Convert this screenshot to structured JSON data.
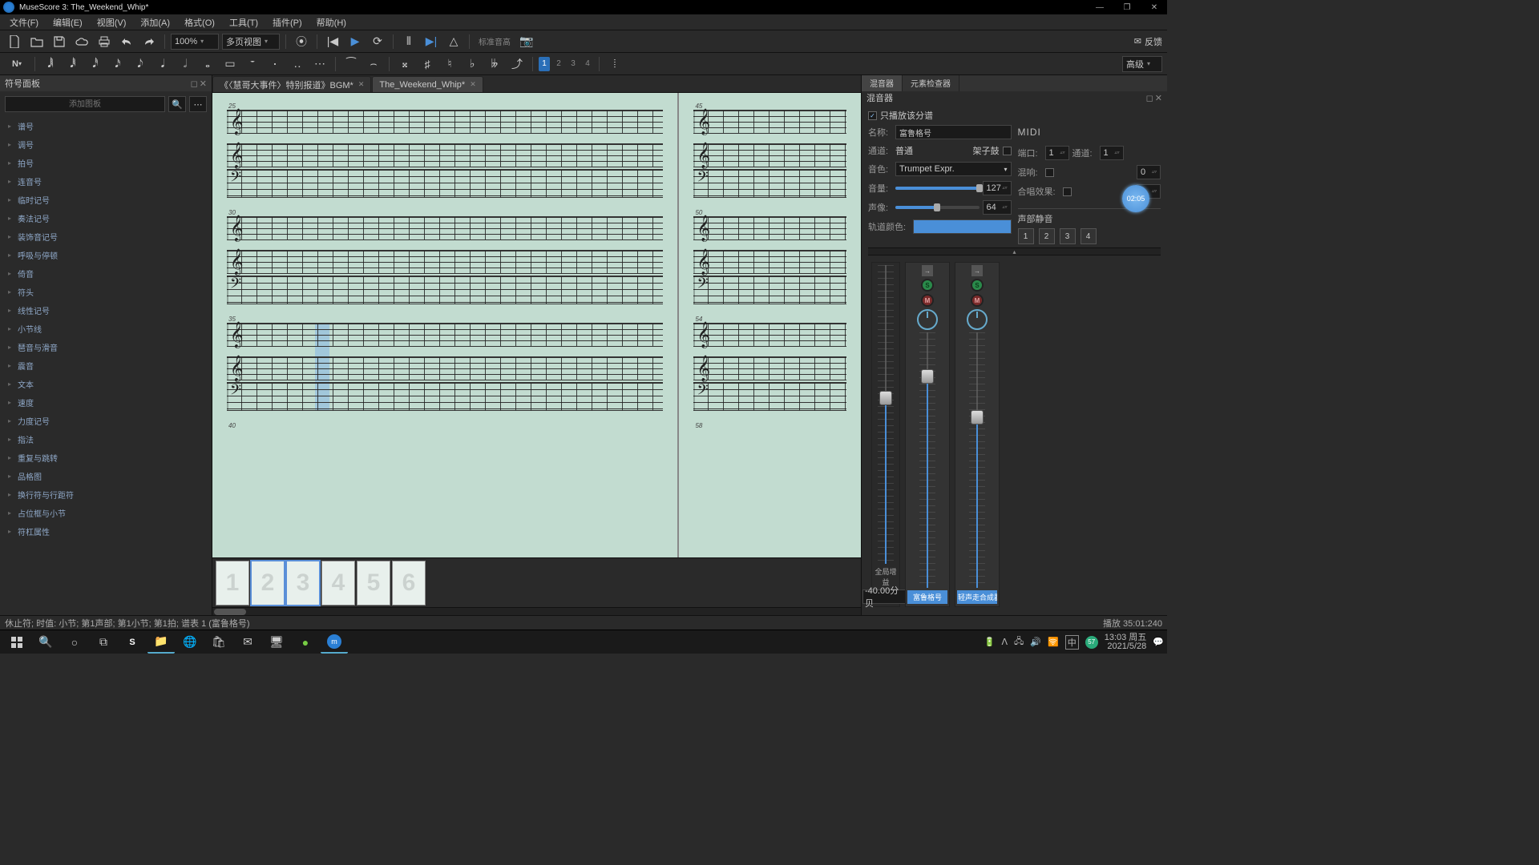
{
  "title": "MuseScore 3: The_Weekend_Whip*",
  "menu": [
    "文件(F)",
    "编辑(E)",
    "视图(V)",
    "添加(A)",
    "格式(O)",
    "工具(T)",
    "插件(P)",
    "帮助(H)"
  ],
  "toolbar1": {
    "zoom": "100%",
    "view": "多页视图",
    "pitch": "标准音高",
    "feedback": "反馈"
  },
  "toolbar2": {
    "voices": [
      "1",
      "2",
      "3",
      "4"
    ],
    "voice_active": 0,
    "level": "高级"
  },
  "palette": {
    "title": "符号面板",
    "search_placeholder": "添加图板",
    "items": [
      "谱号",
      "调号",
      "拍号",
      "连音号",
      "临时记号",
      "奏法记号",
      "装饰音记号",
      "呼吸与停顿",
      "倚音",
      "符头",
      "线性记号",
      "小节线",
      "琶音与滑音",
      "震音",
      "文本",
      "速度",
      "力度记号",
      "指法",
      "重复与跳转",
      "品格图",
      "换行符与行距符",
      "占位框与小节",
      "符杠属性"
    ]
  },
  "docs": [
    {
      "label": "《〈慧哥大事件〉特别报道》BGM*",
      "active": false
    },
    {
      "label": "The_Weekend_Whip*",
      "active": true
    }
  ],
  "score": {
    "measure_nums_left": [
      "25",
      "30",
      "35",
      "40"
    ],
    "measure_nums_right": [
      "45",
      "50",
      "54",
      "58"
    ],
    "pages": [
      1,
      2,
      3,
      4,
      5,
      6
    ],
    "selected_pages": [
      2,
      3
    ]
  },
  "right": {
    "tabs": [
      "混音器",
      "元素检查器"
    ],
    "tab_active": 0,
    "subtitle": "混音器",
    "only_play_sub": "只播放该分谱",
    "name_label": "名称:",
    "name_value": "富鲁格号",
    "channel_label": "通道:",
    "channel_value": "普通",
    "drumset_label": "架子鼓",
    "sound_label": "音色:",
    "sound_value": "Trumpet Expr.",
    "volume_label": "音量:",
    "volume_value": "127",
    "pan_label": "声像:",
    "pan_value": "64",
    "track_color_label": "轨道颜色:",
    "midi_title": "MIDI",
    "port_label": "端口:",
    "port_value": "1",
    "midi_channel_label": "通道:",
    "midi_channel_value": "1",
    "reverb_label": "混响:",
    "reverb_value": "0",
    "chorus_label": "合唱效果:",
    "chorus_value": "0",
    "voice_mute_title": "声部静音",
    "voice_mute": [
      "1",
      "2",
      "3",
      "4"
    ],
    "master_gain_label": "全局增益",
    "master_gain_value": "-40.00分贝",
    "strips": [
      {
        "name": "富鲁格号",
        "fader": 0.72
      },
      {
        "name": "轻声走合成器",
        "fader": 0.58
      }
    ],
    "timer": "02:05"
  },
  "status": {
    "left": "休止符; 时值: 小节; 第1声部; 第1小节; 第1拍; 谱表 1 (富鲁格号)",
    "right": "播放  35:01:240"
  },
  "taskbar": {
    "time": "13:03 周五",
    "date": "2021/5/28",
    "ime": "中"
  }
}
